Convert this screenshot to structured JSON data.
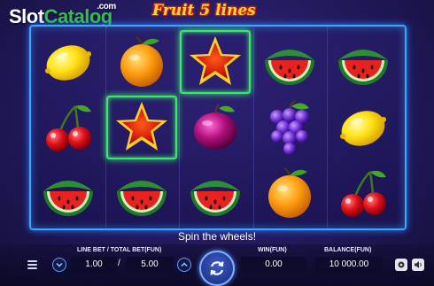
{
  "brand": {
    "slot": "Slot",
    "catalog": "Catalog",
    "com": ".com"
  },
  "game": {
    "title": "Fruit 5 lines"
  },
  "reels": [
    [
      "lemon",
      "cherry",
      "watermelon"
    ],
    [
      "orange",
      "star",
      "watermelon"
    ],
    [
      "star",
      "plum",
      "watermelon"
    ],
    [
      "watermelon",
      "grapes",
      "orange"
    ],
    [
      "watermelon",
      "lemon",
      "cherry"
    ]
  ],
  "winning_cells": [
    [
      1,
      1
    ],
    [
      2,
      0
    ]
  ],
  "status": {
    "message": "Spin the wheels!"
  },
  "controls": {
    "bet_label": "LINE BET / TOTAL BET(FUN)",
    "line_bet": "1.00",
    "separator": "/",
    "total_bet": "5.00",
    "win_label": "WIN(FUN)",
    "win": "0.00",
    "balance_label": "BALANCE(FUN)",
    "balance": "10 000.00"
  },
  "colors": {
    "frame": "#35a8ff",
    "win_highlight": "#39e86a",
    "title": "#ffd23a"
  }
}
